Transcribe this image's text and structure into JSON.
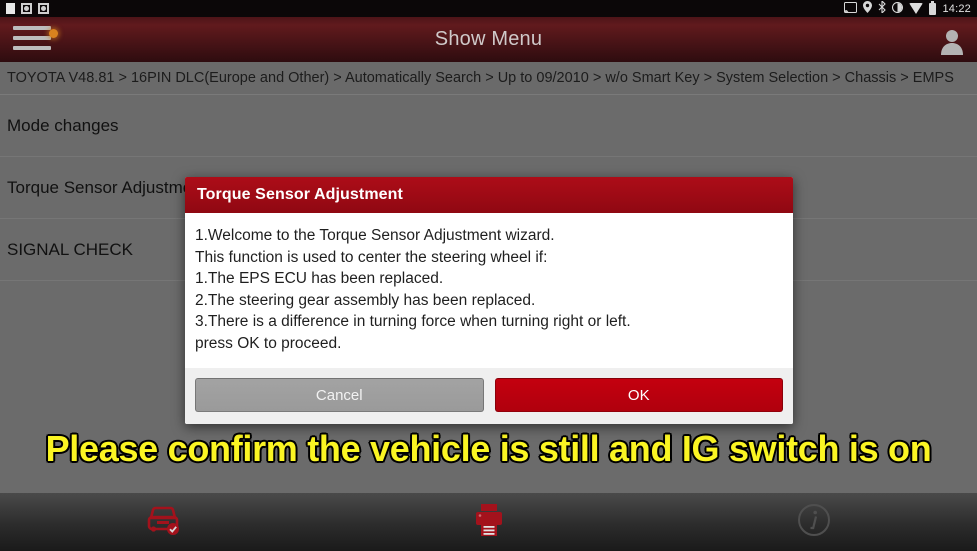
{
  "statusbar": {
    "time": "14:22",
    "left_icons": [
      "notification-square-icon",
      "screenshot-icon",
      "screenshot-icon"
    ],
    "right_icons": [
      "cast-icon",
      "location-pin-icon",
      "bluetooth-icon",
      "vibrate-icon",
      "wifi-icon",
      "battery-icon"
    ]
  },
  "titlebar": {
    "title": "Show Menu",
    "menu_icon": "hamburger-menu-icon",
    "menu_badge": "new-notification-dot",
    "user_icon": "user-profile-icon",
    "background_color": "#5a1619"
  },
  "breadcrumb": {
    "path": "TOYOTA V48.81 > 16PIN DLC(Europe and Other) > Automatically Search > Up to 09/2010 > w/o Smart Key > System Selection > Chassis > EMPS"
  },
  "menu": {
    "items": [
      {
        "label": "Mode changes"
      },
      {
        "label": "Torque Sensor Adjustment"
      },
      {
        "label": "SIGNAL CHECK"
      }
    ]
  },
  "dialog": {
    "title": "Torque Sensor Adjustment",
    "lines": [
      "1.Welcome to the Torque Sensor Adjustment wizard.",
      "This function is used to center the steering wheel if:",
      "1.The EPS ECU has been replaced.",
      "2.The steering gear assembly has been replaced.",
      "3.There is a difference in turning force when turning right or left.",
      "press OK to proceed."
    ],
    "cancel_label": "Cancel",
    "ok_label": "OK",
    "header_color": "#9d0a15",
    "ok_color": "#c4000f"
  },
  "warning": {
    "text": "Please confirm the vehicle is still and IG switch is on",
    "color": "#fbf523"
  },
  "bottombar": {
    "items": [
      {
        "icon": "vehicle-check-icon"
      },
      {
        "icon": "printer-icon"
      },
      {
        "icon": "info-icon"
      }
    ]
  }
}
